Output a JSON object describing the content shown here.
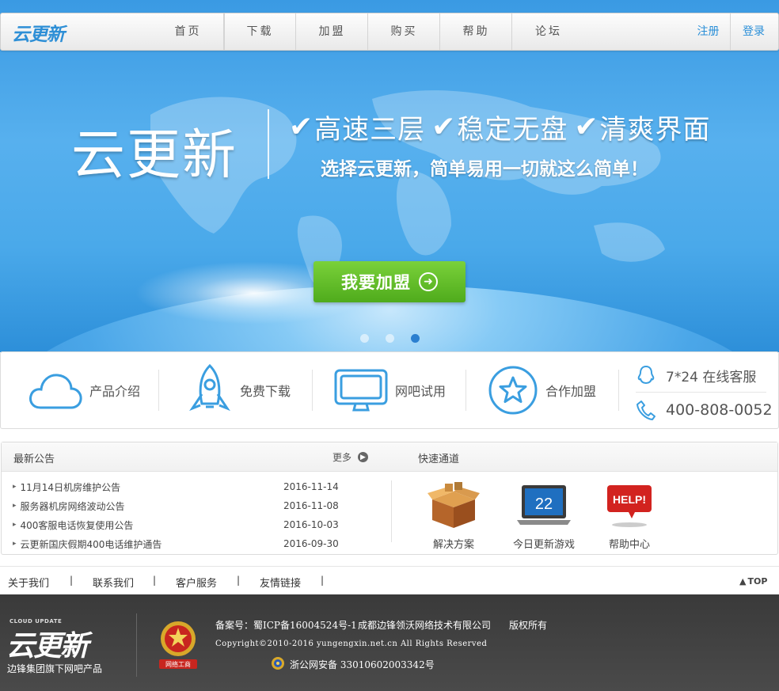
{
  "nav": {
    "logo": "云更新",
    "items": [
      "首页",
      "下载",
      "加盟",
      "购买",
      "帮助",
      "论坛"
    ],
    "register": "注册",
    "login": "登录"
  },
  "hero": {
    "brand": "云更新",
    "features": [
      "高速三层",
      "稳定无盘",
      "清爽界面"
    ],
    "slogan": "选择云更新，简单易用一切就这么简单！",
    "join_button": "我要加盟",
    "slide_count": 3,
    "active_slide": 3
  },
  "services": {
    "items": [
      "产品介绍",
      "免费下载",
      "网吧试用",
      "合作加盟"
    ],
    "hotline": "7*24 在线客服",
    "phone": "400-808-0052"
  },
  "news": {
    "title": "最新公告",
    "more": "更多",
    "rows": [
      {
        "text": "11月14日机房维护公告",
        "date": "2016-11-14"
      },
      {
        "text": "服务器机房网络波动公告",
        "date": "2016-11-08"
      },
      {
        "text": "400客服电话恢复使用公告",
        "date": "2016-10-03"
      },
      {
        "text": "云更新国庆假期400电话维护通告",
        "date": "2016-09-30"
      }
    ]
  },
  "quick": {
    "title": "快速通道",
    "items": [
      "解决方案",
      "今日更新游戏",
      "帮助中心"
    ],
    "games_count": "22",
    "help_text": "HELP!"
  },
  "links": {
    "items": [
      "关于我们",
      "联系我们",
      "客户服务",
      "友情链接"
    ],
    "separator": "|",
    "top": "TOP"
  },
  "footer": {
    "cloud_update": "CLOUD UPDATE",
    "brand": "云更新",
    "sub": "边锋集团旗下网吧产品",
    "icp": "备案号：蜀ICP备16004524号-1",
    "company": "成都边锋领沃网络技术有限公司",
    "rights": "版权所有",
    "copyright": "Copyright©2010-2016 yungengxin.net.cn All Rights Reserved",
    "police": "浙公网安备 33010602003342号",
    "badge_text": "网络工商"
  },
  "colors": {
    "accent": "#2a8fd8",
    "green": "#5bb724",
    "footer_bg": "#404040"
  }
}
